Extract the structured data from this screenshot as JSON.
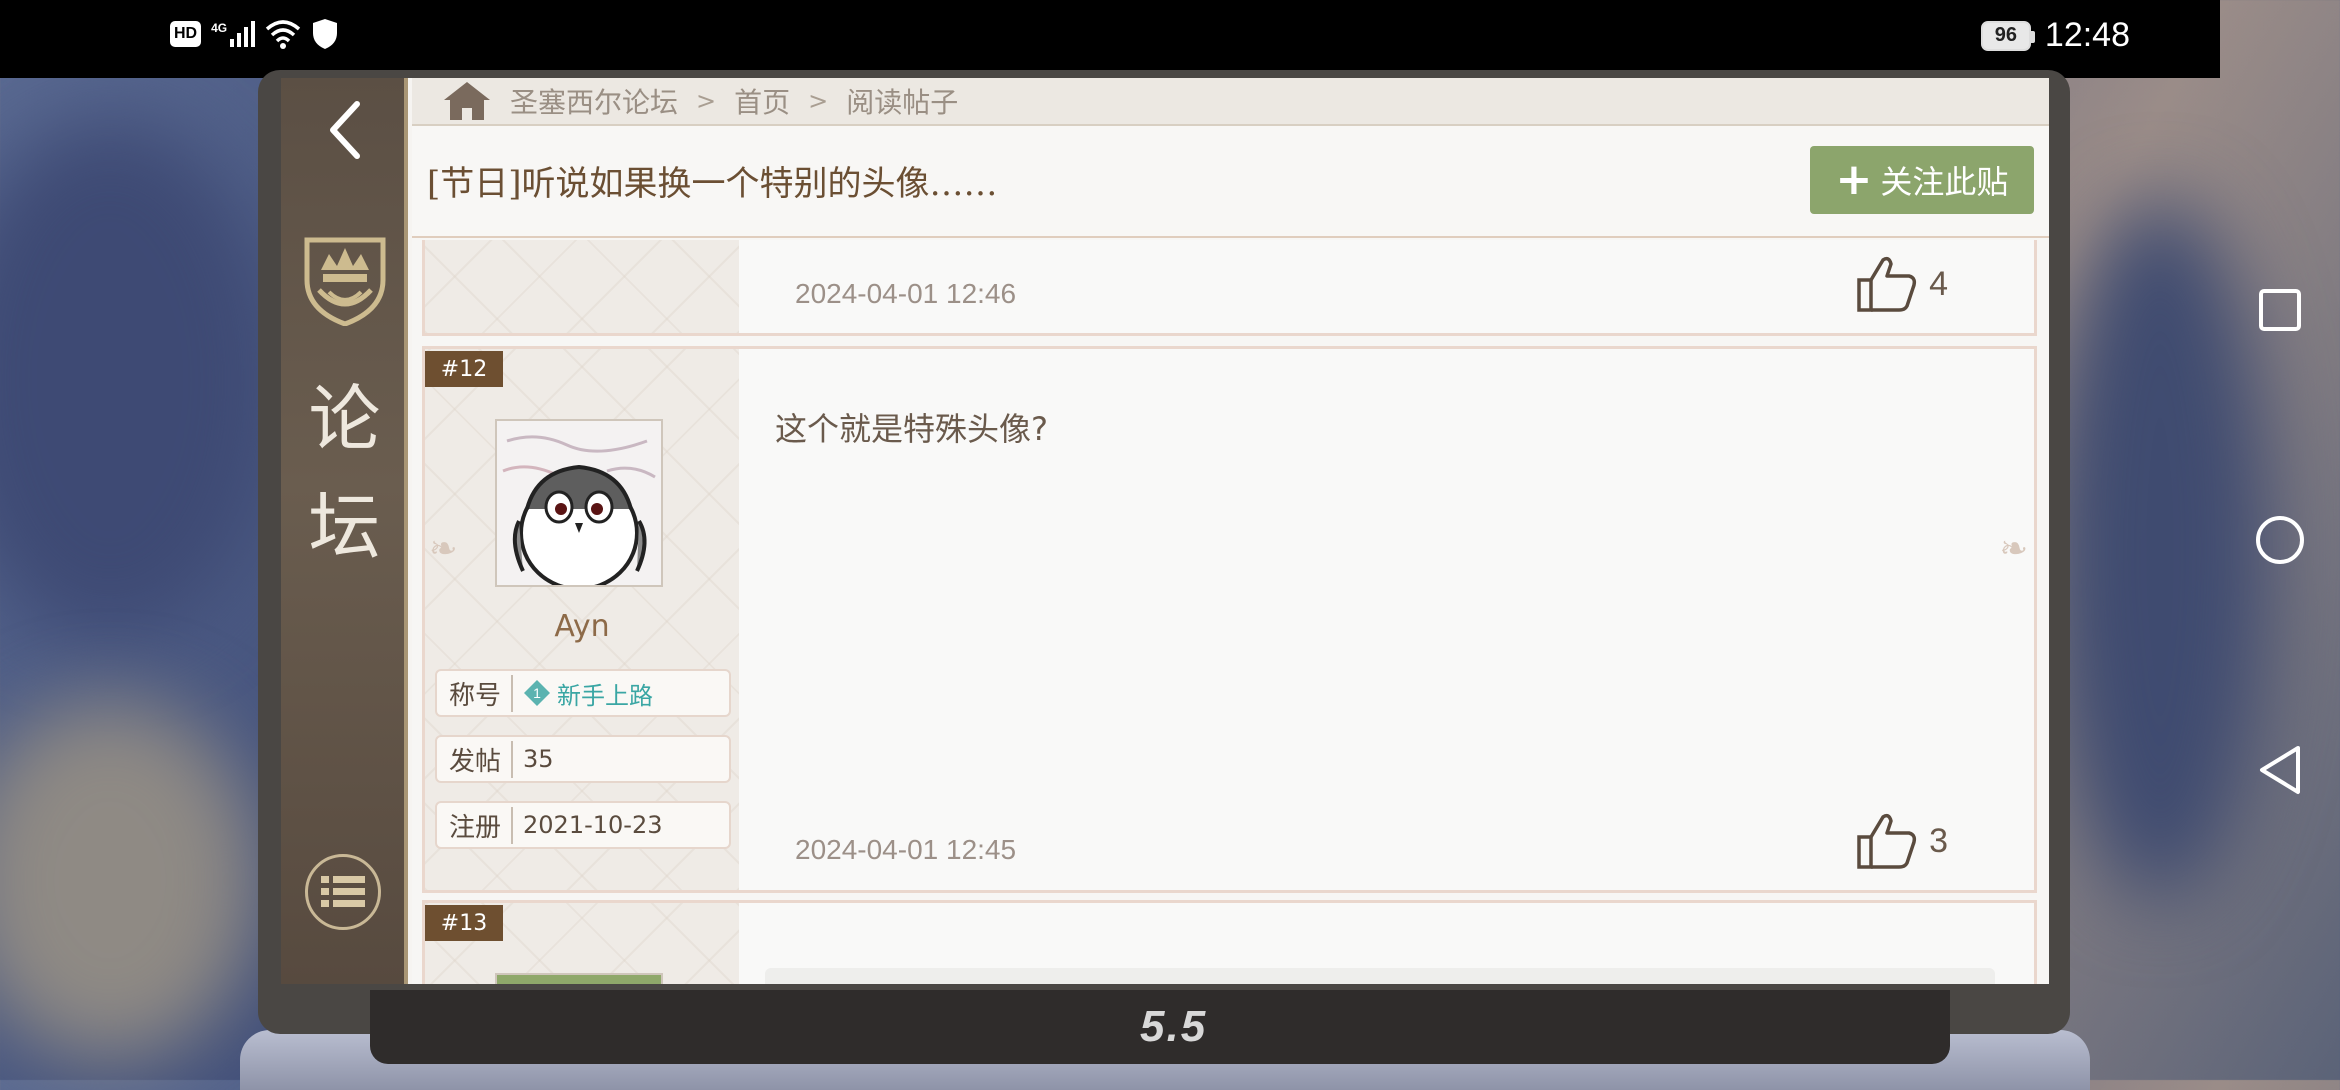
{
  "status_bar": {
    "hd": "HD",
    "network": "4G",
    "battery": "96",
    "time": "12:48"
  },
  "breadcrumb": {
    "items": [
      "圣塞西尔论坛",
      "首页",
      "阅读帖子"
    ]
  },
  "sidebar": {
    "title_chars": [
      "论",
      "坛"
    ]
  },
  "thread": {
    "title": "[节日]听说如果换一个特别的头像……",
    "follow_label": "关注此贴"
  },
  "posts": [
    {
      "time": "2024-04-01  12:46",
      "likes": "4"
    },
    {
      "floor": "#12",
      "username": "Ayn",
      "title_label": "称号",
      "title_value": "新手上路",
      "title_level": "1",
      "posts_label": "发帖",
      "posts_value": "35",
      "reg_label": "注册",
      "reg_value": "2021-10-23",
      "body": "这个就是特殊头像?",
      "time": "2024-04-01  12:45",
      "likes": "3"
    },
    {
      "floor": "#13"
    }
  ],
  "laptop_logo": "5.5",
  "colors": {
    "accent_green": "#8ca56c",
    "title_brown": "#6b4f33",
    "floor_tag": "#6e4f30",
    "badge_teal": "#3aa6a4"
  }
}
